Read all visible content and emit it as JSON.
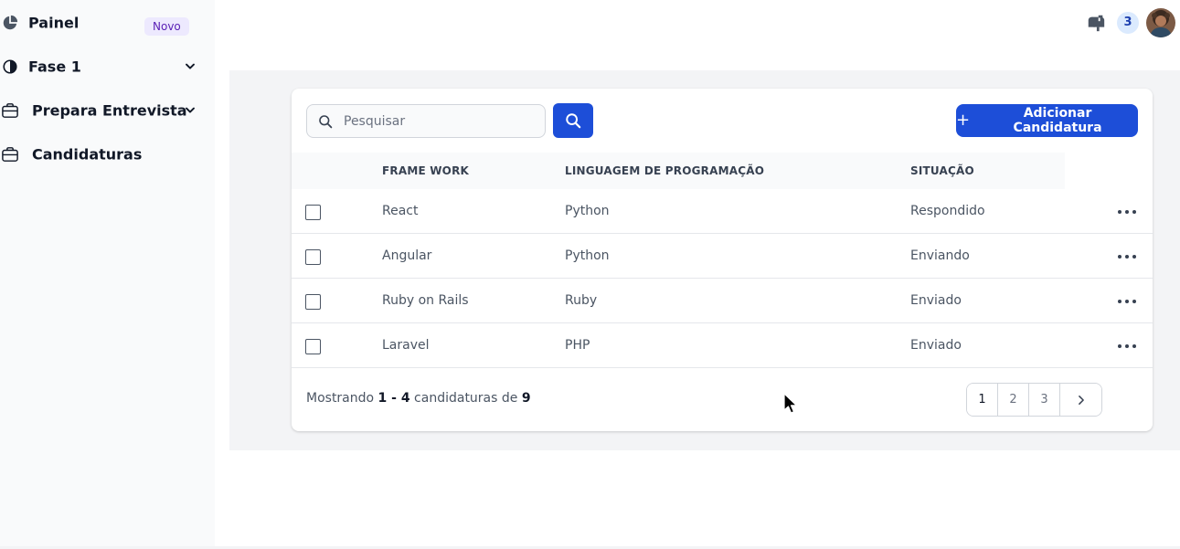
{
  "sidebar": {
    "items": [
      {
        "label": "Painel",
        "badge": "Novo",
        "icon": "pie-chart-icon"
      },
      {
        "label": "Fase 1",
        "icon": "half-circle-icon",
        "expandable": true
      },
      {
        "label": "Prepara Entrevista",
        "icon": "briefcase-icon",
        "expandable": true
      },
      {
        "label": "Candidaturas",
        "icon": "briefcase-icon"
      }
    ]
  },
  "topbar": {
    "notification_icon": "mailbox-icon",
    "notification_count": "3",
    "avatar": "user-avatar"
  },
  "toolbar": {
    "search_placeholder": "Pesquisar",
    "search_value": "",
    "add_label": "Adicionar Candidatura"
  },
  "table": {
    "columns": [
      "FRAME WORK",
      "LINGUAGEM DE PROGRAMAÇÃO",
      "SITUAÇÃO"
    ],
    "rows": [
      {
        "framework": "React",
        "language": "Python",
        "status": "Respondido"
      },
      {
        "framework": "Angular",
        "language": "Python",
        "status": "Enviando"
      },
      {
        "framework": "Ruby on Rails",
        "language": "Ruby",
        "status": "Enviado"
      },
      {
        "framework": "Laravel",
        "language": "PHP",
        "status": "Enviado"
      }
    ]
  },
  "footer": {
    "prefix": "Mostrando",
    "range": "1 - 4",
    "middle": "candidaturas de",
    "total": "9"
  },
  "pagination": {
    "pages": [
      "1",
      "2",
      "3"
    ],
    "current": "1"
  },
  "colors": {
    "primary": "#1d4ed8",
    "badge_bg": "#ede9fe",
    "badge_text": "#5b21b6",
    "page_bg": "#f3f4f6"
  }
}
